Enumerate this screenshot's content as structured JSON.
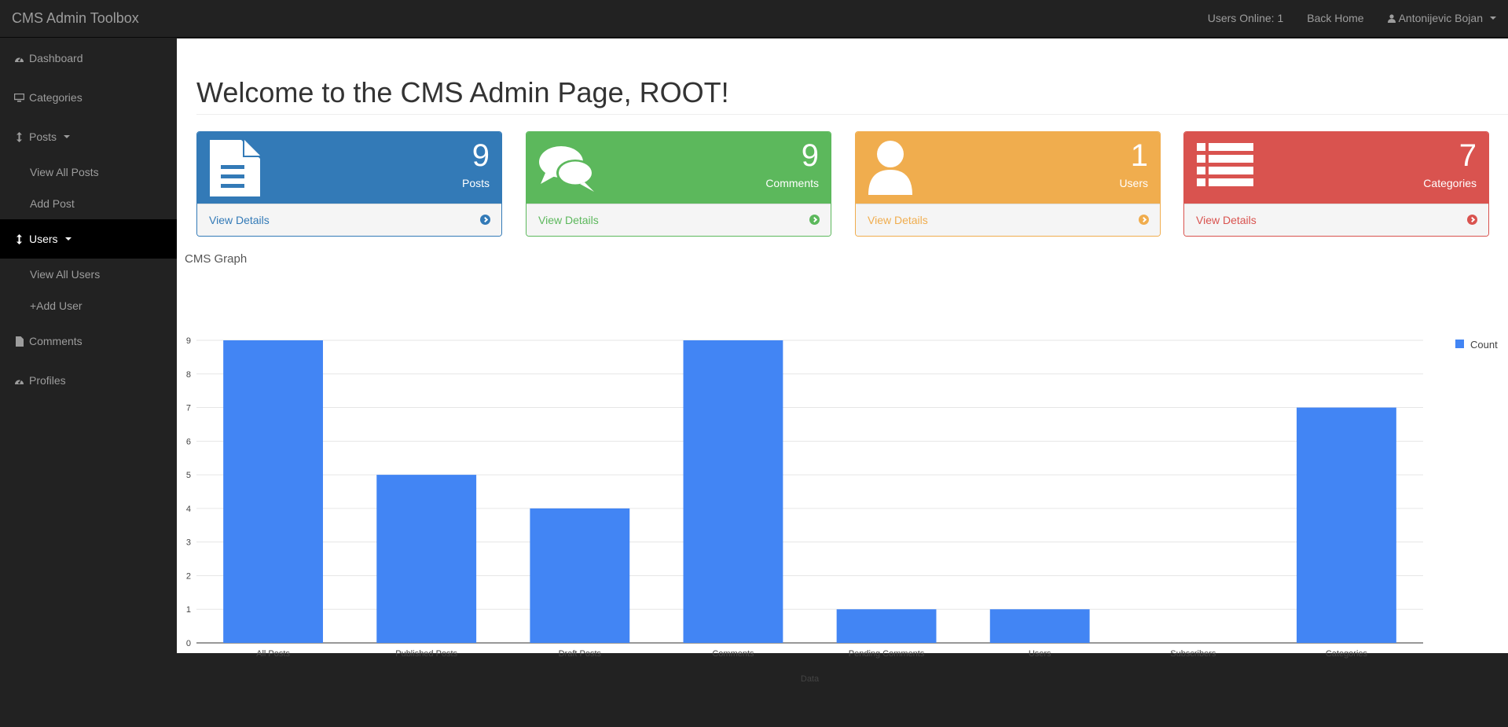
{
  "navbar": {
    "brand": "CMS Admin Toolbox",
    "users_online": "Users Online: 1",
    "back_home": "Back Home",
    "user_name": "Antonijevic Bojan"
  },
  "sidebar": {
    "items": [
      {
        "label": "Dashboard",
        "icon": "dashboard-icon"
      },
      {
        "label": "Categories",
        "icon": "desktop-icon"
      },
      {
        "label": "Posts",
        "icon": "arrows-v-icon"
      },
      {
        "label": "View All Posts"
      },
      {
        "label": "Add Post"
      },
      {
        "label": "Users",
        "icon": "arrows-v-icon"
      },
      {
        "label": "View All Users"
      },
      {
        "label": "+Add User"
      },
      {
        "label": "Comments",
        "icon": "file-icon"
      },
      {
        "label": "Profiles",
        "icon": "dashboard-icon"
      }
    ]
  },
  "main": {
    "title": "Welcome to the CMS Admin Page, ROOT!",
    "graph_title": "CMS Graph"
  },
  "panels": [
    {
      "count": "9",
      "label": "Posts",
      "link": "View Details",
      "color": "#337ab7",
      "icon": "file-text-icon"
    },
    {
      "count": "9",
      "label": "Comments",
      "link": "View Details",
      "color": "#5cb85c",
      "icon": "comments-icon"
    },
    {
      "count": "1",
      "label": "Users",
      "link": "View Details",
      "color": "#f0ad4e",
      "icon": "user-icon"
    },
    {
      "count": "7",
      "label": "Categories",
      "link": "View Details",
      "color": "#d9534f",
      "icon": "list-icon"
    }
  ],
  "chart_data": {
    "type": "bar",
    "categories": [
      "All Posts",
      "Published Posts",
      "Draft Posts",
      "Comments",
      "Pending Comments",
      "Users",
      "Subscribers",
      "Categories"
    ],
    "series": [
      {
        "name": "Count",
        "values": [
          9,
          5,
          4,
          9,
          1,
          1,
          0,
          7
        ],
        "color": "#4285f4"
      }
    ],
    "xlabel": "Data",
    "ylabel": "",
    "ylim": [
      0,
      9
    ],
    "yticks": [
      0,
      1,
      2,
      3,
      4,
      5,
      6,
      7,
      8,
      9
    ],
    "grid": true,
    "legend": "right"
  }
}
